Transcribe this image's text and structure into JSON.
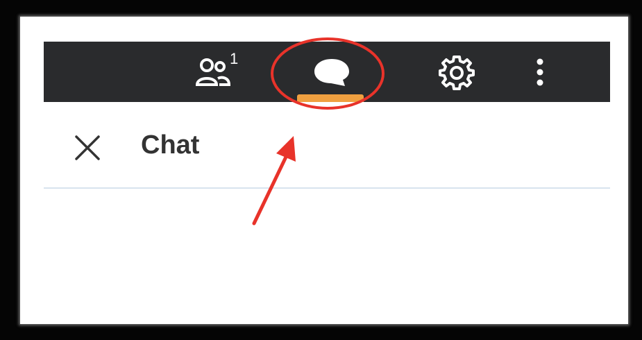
{
  "toolbar": {
    "participants_icon": "people-icon",
    "participants_count": "1",
    "chat_icon": "chat-bubble-icon",
    "settings_icon": "gear-icon",
    "more_icon": "more-vertical-icon",
    "active_tab_color": "#f0a040",
    "background_color": "#2a2b2d"
  },
  "chat_panel": {
    "close_icon": "close-icon",
    "title": "Chat"
  },
  "annotation": {
    "color": "#e8332a"
  }
}
